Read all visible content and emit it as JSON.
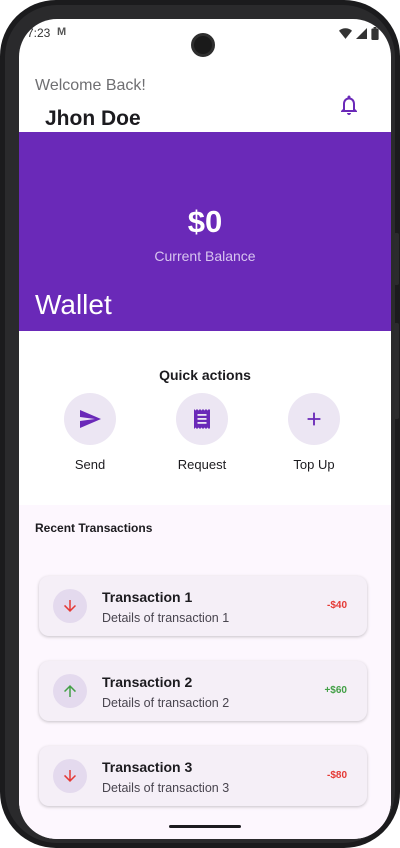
{
  "status_bar": {
    "time": "7:23",
    "mail_icon": "M"
  },
  "header": {
    "welcome": "Welcome Back!",
    "username": "Jhon Doe",
    "notification_icon": "bell-icon"
  },
  "banner": {
    "balance": "$0",
    "balance_label": "Current Balance",
    "title": "Wallet",
    "color": "#6a29b8"
  },
  "quick_actions": {
    "title": "Quick actions",
    "items": [
      {
        "label": "Send",
        "icon": "send-icon"
      },
      {
        "label": "Request",
        "icon": "receipt-icon"
      },
      {
        "label": "Top Up",
        "icon": "plus-icon"
      }
    ]
  },
  "transactions": {
    "title": "Recent Transactions",
    "items": [
      {
        "name": "Transaction 1",
        "details": "Details of transaction 1",
        "amount": "-$40",
        "direction": "down",
        "color": "#e53935"
      },
      {
        "name": "Transaction 2",
        "details": "Details of transaction 2",
        "amount": "+$60",
        "direction": "up",
        "color": "#43a047"
      },
      {
        "name": "Transaction 3",
        "details": "Details of transaction 3",
        "amount": "-$80",
        "direction": "down",
        "color": "#e53935"
      }
    ]
  }
}
